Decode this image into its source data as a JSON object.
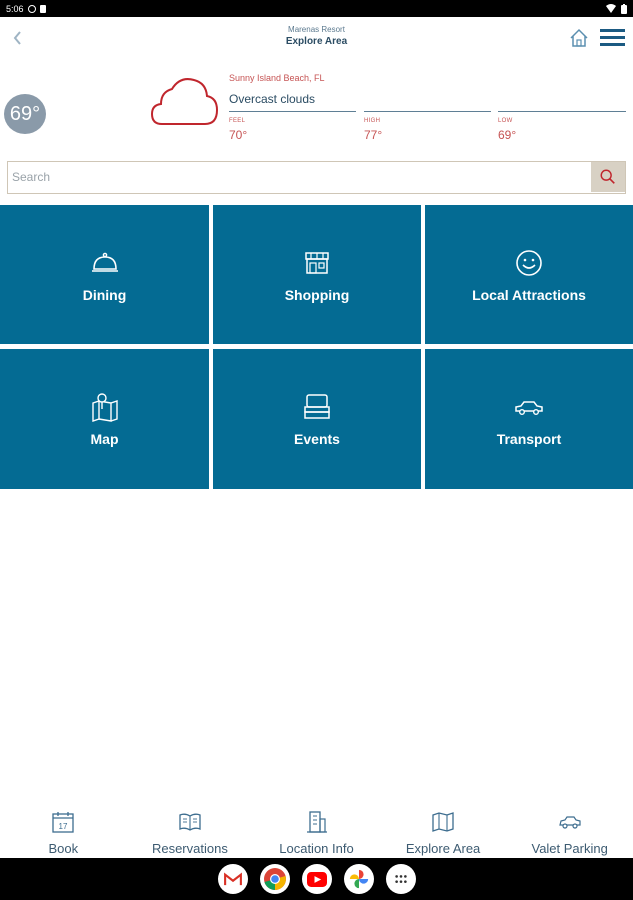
{
  "status_bar": {
    "time": "5:06"
  },
  "header": {
    "subtitle": "Marenas Resort",
    "title": "Explore Area",
    "icons": [
      "back-chevron-icon",
      "home-icon",
      "hamburger-menu-icon"
    ]
  },
  "weather": {
    "current_temp": "69°",
    "icon": "cloud-icon",
    "location": "Sunny Island Beach, FL",
    "condition": "Overcast clouds",
    "feels_label": "FEEL",
    "feels_value": "70°",
    "high_label": "HIGH",
    "high_value": "77°",
    "low_label": "LOW",
    "low_value": "69°"
  },
  "search": {
    "placeholder": "Search",
    "value": ""
  },
  "tiles": [
    {
      "label": "Dining",
      "icon": "cloche-icon"
    },
    {
      "label": "Shopping",
      "icon": "storefront-icon"
    },
    {
      "label": "Local Attractions",
      "icon": "smiley-icon"
    },
    {
      "label": "Map",
      "icon": "map-pin-icon"
    },
    {
      "label": "Events",
      "icon": "stage-icon"
    },
    {
      "label": "Transport",
      "icon": "car-icon"
    }
  ],
  "bottom_nav": [
    {
      "label": "Book",
      "icon": "calendar-icon",
      "calendar_day": "17"
    },
    {
      "label": "Reservations",
      "icon": "open-book-icon"
    },
    {
      "label": "Location Info",
      "icon": "building-icon"
    },
    {
      "label": "Explore Area",
      "icon": "map-icon"
    },
    {
      "label": "Valet Parking",
      "icon": "valet-car-icon"
    }
  ],
  "dock_apps": [
    "gmail-icon",
    "chrome-icon",
    "youtube-icon",
    "photos-icon",
    "app-drawer-icon"
  ],
  "colors": {
    "tile_bg": "#046b93",
    "accent_red": "#c65454",
    "text_navy": "#2b4c63",
    "search_button_bg": "#d8d1c4",
    "temp_badge_bg": "#8a9aa9"
  }
}
